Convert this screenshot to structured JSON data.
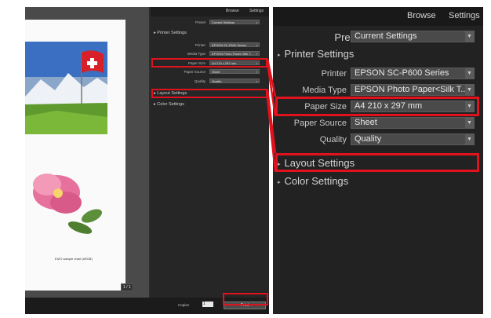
{
  "left": {
    "tabs": [
      "Browse",
      "Settings"
    ],
    "preset_label": "Preset",
    "preset_value": "Current Settings",
    "printer_settings": "Printer Settings",
    "rows": [
      {
        "label": "Printer",
        "value": "EPSON SC-P600 Series"
      },
      {
        "label": "Media Type",
        "value": "EPSON Photo Paper<Silk T..."
      },
      {
        "label": "Paper Size",
        "value": "A4 210 x 297 mm"
      },
      {
        "label": "Paper Source",
        "value": "Sheet"
      },
      {
        "label": "Quality",
        "value": "Quality"
      }
    ],
    "layout_settings": "Layout Settings",
    "color_settings": "Color Settings",
    "caption": "EIZO sample chart (sRGB)",
    "page_nav": "1 / 1",
    "copies_label": "Copies",
    "copies_value": "1",
    "print_label": "Print"
  },
  "right": {
    "tabs": [
      "Browse",
      "Settings"
    ],
    "preset_label": "Preset",
    "preset_value": "Current Settings",
    "printer_settings": "Printer Settings",
    "rows": [
      {
        "label": "Printer",
        "value": "EPSON SC-P600 Series"
      },
      {
        "label": "Media Type",
        "value": "EPSON Photo Paper<Silk T..."
      },
      {
        "label": "Paper Size",
        "value": "A4 210 x 297 mm"
      },
      {
        "label": "Paper Source",
        "value": "Sheet"
      },
      {
        "label": "Quality",
        "value": "Quality"
      }
    ],
    "layout_settings": "Layout Settings",
    "color_settings": "Color Settings"
  },
  "colors": {
    "highlight": "#e0121d",
    "panel_bg": "#222222",
    "select_bg": "#4a4a4a"
  }
}
